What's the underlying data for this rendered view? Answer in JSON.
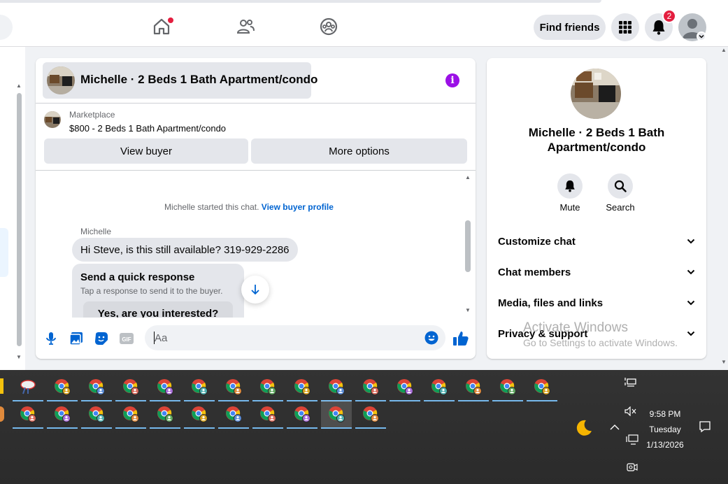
{
  "navbar": {
    "home_icon": "home-icon",
    "friends_icon": "friends-icon",
    "groups_icon": "groups-icon",
    "find_friends": "Find friends",
    "menu_icon": "grid-menu-icon",
    "notifications_icon": "bell-icon",
    "notifications_count": "2",
    "avatar_icon": "profile-avatar"
  },
  "chat": {
    "header_title": "Michelle · 2 Beds 1 Bath Apartment/condo",
    "info_icon": "i",
    "marketplace_label": "Marketplace",
    "listing": "$800 - 2 Beds 1 Bath Apartment/condo",
    "view_buyer": "View buyer",
    "more_options": "More options",
    "started_text": "Michelle started this chat.",
    "view_buyer_profile": "View buyer profile",
    "sender": "Michelle",
    "message": "Hi Steve, is this still available? 319-929-2286",
    "quick_title": "Send a quick response",
    "quick_subtitle": "Tap a response to send it to the buyer.",
    "quick_reply": "Yes, are you interested?",
    "composer_placeholder": "Aa",
    "composer_icons": [
      "mic-icon",
      "photo-icon",
      "sticker-icon",
      "gif-icon"
    ],
    "gif_label": "GIF"
  },
  "info_panel": {
    "name": "Michelle · 2 Beds 1 Bath Apartment/condo",
    "mute": "Mute",
    "search": "Search",
    "sections": [
      "Customize chat",
      "Chat members",
      "Media, files and links",
      "Privacy & support"
    ]
  },
  "watermark": {
    "line1": "Activate Windows",
    "line2": "Go to Settings to activate Windows."
  },
  "taskbar": {
    "clock_time": "9:58 PM",
    "clock_day": "Tuesday",
    "clock_date": "1/13/2026",
    "tray_icons": [
      "network-icon",
      "volume-muted-icon",
      "night-light-icon",
      "show-hidden-icons",
      "notification-center-icon",
      "camera-icon"
    ]
  },
  "colors": {
    "accent": "#0064d1",
    "info_purple": "#9b10e6",
    "badge_red": "#e41e3f"
  }
}
